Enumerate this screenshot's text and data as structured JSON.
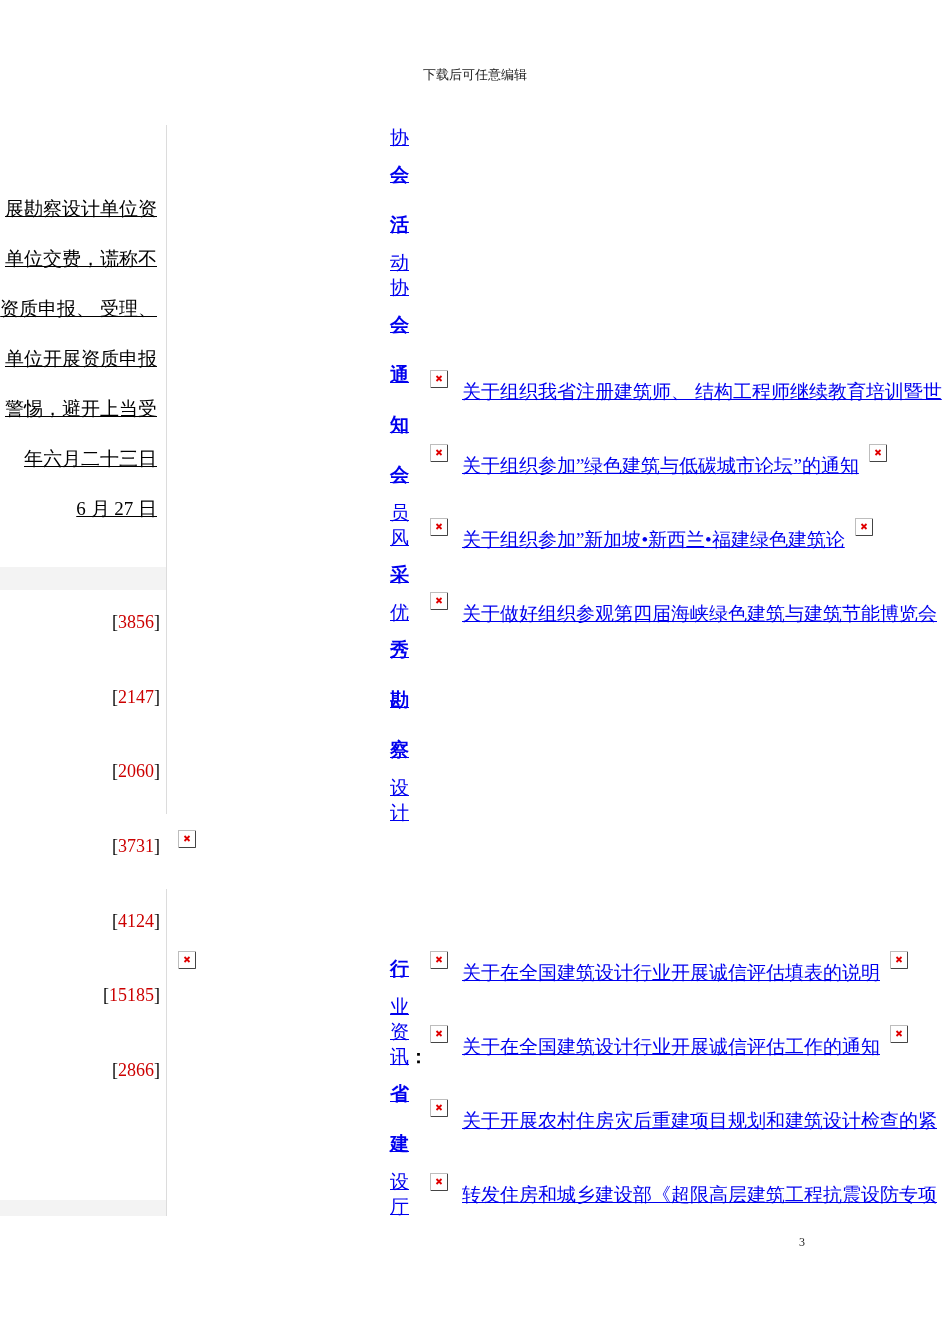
{
  "header": "下载后可任意编辑",
  "notice": {
    "lines": [
      "展勘察设计单位资",
      "单位交费，谎称不",
      "资质申报、 受理、",
      "单位开展资质申报",
      "警惕，避开上当受",
      "年六月二十三日",
      "6 月 27 日"
    ]
  },
  "counts": [
    {
      "kind": "count",
      "text": "[3856]"
    },
    {
      "kind": "count",
      "text": "[2147]"
    },
    {
      "kind": "count",
      "text": "[2060]"
    },
    {
      "kind": "count_image",
      "text": "[3731]"
    },
    {
      "kind": "count",
      "text": "[4124]"
    },
    {
      "kind": "image"
    },
    {
      "kind": "count",
      "text": "[15185]"
    },
    {
      "kind": "count",
      "text": "[2866]"
    }
  ],
  "sections": [
    {
      "nav": [
        {
          "label": "协**会活**动"
        },
        {
          "label": "协**会通知**"
        },
        {
          "label": "**会**员风**采**"
        },
        {
          "label": "优**秀勘察**设计"
        }
      ],
      "items": [
        {
          "title": "关于组织我省注册建筑师、 结构工程师继续教育培训暨世",
          "image_after": false
        },
        {
          "title": "关于组织参加”绿色建筑与低碳城市论坛”的通知",
          "image_after": true
        },
        {
          "title": "关于组织参加”新加坡•新西兰•福建绿色建筑论",
          "image_after": true
        },
        {
          "title": "关于做好组织参观第四届海峡绿色建筑与建筑节能博览会",
          "image_after": false
        }
      ]
    },
    {
      "nav": [
        {
          "label": "**行**业资讯",
          "suffix": "："
        },
        {
          "label": "**省建**设厅"
        }
      ],
      "items": [
        {
          "title": "关于在全国建筑设计行业开展诚信评估填表的说明",
          "image_after": true
        },
        {
          "title": "关于在全国建筑设计行业开展诚信评估工作的通知",
          "image_after": true
        },
        {
          "title": "关于开展农村住房灾后重建项目规划和建筑设计检查的紧",
          "image_after": false
        },
        {
          "title": "转发住房和城乡建设部《超限高层建筑工程抗震设防专项",
          "image_after": false
        }
      ]
    }
  ],
  "page_number": "3"
}
